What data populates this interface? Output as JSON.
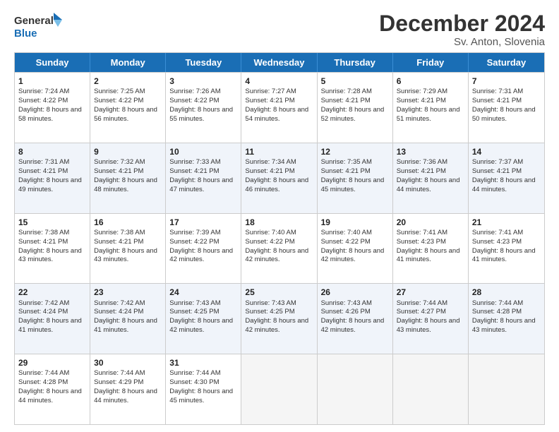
{
  "logo": {
    "line1": "General",
    "line2": "Blue"
  },
  "title": "December 2024",
  "subtitle": "Sv. Anton, Slovenia",
  "days": [
    "Sunday",
    "Monday",
    "Tuesday",
    "Wednesday",
    "Thursday",
    "Friday",
    "Saturday"
  ],
  "weeks": [
    [
      {
        "day": "1",
        "sunrise": "Sunrise: 7:24 AM",
        "sunset": "Sunset: 4:22 PM",
        "daylight": "Daylight: 8 hours and 58 minutes."
      },
      {
        "day": "2",
        "sunrise": "Sunrise: 7:25 AM",
        "sunset": "Sunset: 4:22 PM",
        "daylight": "Daylight: 8 hours and 56 minutes."
      },
      {
        "day": "3",
        "sunrise": "Sunrise: 7:26 AM",
        "sunset": "Sunset: 4:22 PM",
        "daylight": "Daylight: 8 hours and 55 minutes."
      },
      {
        "day": "4",
        "sunrise": "Sunrise: 7:27 AM",
        "sunset": "Sunset: 4:21 PM",
        "daylight": "Daylight: 8 hours and 54 minutes."
      },
      {
        "day": "5",
        "sunrise": "Sunrise: 7:28 AM",
        "sunset": "Sunset: 4:21 PM",
        "daylight": "Daylight: 8 hours and 52 minutes."
      },
      {
        "day": "6",
        "sunrise": "Sunrise: 7:29 AM",
        "sunset": "Sunset: 4:21 PM",
        "daylight": "Daylight: 8 hours and 51 minutes."
      },
      {
        "day": "7",
        "sunrise": "Sunrise: 7:31 AM",
        "sunset": "Sunset: 4:21 PM",
        "daylight": "Daylight: 8 hours and 50 minutes."
      }
    ],
    [
      {
        "day": "8",
        "sunrise": "Sunrise: 7:31 AM",
        "sunset": "Sunset: 4:21 PM",
        "daylight": "Daylight: 8 hours and 49 minutes."
      },
      {
        "day": "9",
        "sunrise": "Sunrise: 7:32 AM",
        "sunset": "Sunset: 4:21 PM",
        "daylight": "Daylight: 8 hours and 48 minutes."
      },
      {
        "day": "10",
        "sunrise": "Sunrise: 7:33 AM",
        "sunset": "Sunset: 4:21 PM",
        "daylight": "Daylight: 8 hours and 47 minutes."
      },
      {
        "day": "11",
        "sunrise": "Sunrise: 7:34 AM",
        "sunset": "Sunset: 4:21 PM",
        "daylight": "Daylight: 8 hours and 46 minutes."
      },
      {
        "day": "12",
        "sunrise": "Sunrise: 7:35 AM",
        "sunset": "Sunset: 4:21 PM",
        "daylight": "Daylight: 8 hours and 45 minutes."
      },
      {
        "day": "13",
        "sunrise": "Sunrise: 7:36 AM",
        "sunset": "Sunset: 4:21 PM",
        "daylight": "Daylight: 8 hours and 44 minutes."
      },
      {
        "day": "14",
        "sunrise": "Sunrise: 7:37 AM",
        "sunset": "Sunset: 4:21 PM",
        "daylight": "Daylight: 8 hours and 44 minutes."
      }
    ],
    [
      {
        "day": "15",
        "sunrise": "Sunrise: 7:38 AM",
        "sunset": "Sunset: 4:21 PM",
        "daylight": "Daylight: 8 hours and 43 minutes."
      },
      {
        "day": "16",
        "sunrise": "Sunrise: 7:38 AM",
        "sunset": "Sunset: 4:21 PM",
        "daylight": "Daylight: 8 hours and 43 minutes."
      },
      {
        "day": "17",
        "sunrise": "Sunrise: 7:39 AM",
        "sunset": "Sunset: 4:22 PM",
        "daylight": "Daylight: 8 hours and 42 minutes."
      },
      {
        "day": "18",
        "sunrise": "Sunrise: 7:40 AM",
        "sunset": "Sunset: 4:22 PM",
        "daylight": "Daylight: 8 hours and 42 minutes."
      },
      {
        "day": "19",
        "sunrise": "Sunrise: 7:40 AM",
        "sunset": "Sunset: 4:22 PM",
        "daylight": "Daylight: 8 hours and 42 minutes."
      },
      {
        "day": "20",
        "sunrise": "Sunrise: 7:41 AM",
        "sunset": "Sunset: 4:23 PM",
        "daylight": "Daylight: 8 hours and 41 minutes."
      },
      {
        "day": "21",
        "sunrise": "Sunrise: 7:41 AM",
        "sunset": "Sunset: 4:23 PM",
        "daylight": "Daylight: 8 hours and 41 minutes."
      }
    ],
    [
      {
        "day": "22",
        "sunrise": "Sunrise: 7:42 AM",
        "sunset": "Sunset: 4:24 PM",
        "daylight": "Daylight: 8 hours and 41 minutes."
      },
      {
        "day": "23",
        "sunrise": "Sunrise: 7:42 AM",
        "sunset": "Sunset: 4:24 PM",
        "daylight": "Daylight: 8 hours and 41 minutes."
      },
      {
        "day": "24",
        "sunrise": "Sunrise: 7:43 AM",
        "sunset": "Sunset: 4:25 PM",
        "daylight": "Daylight: 8 hours and 42 minutes."
      },
      {
        "day": "25",
        "sunrise": "Sunrise: 7:43 AM",
        "sunset": "Sunset: 4:25 PM",
        "daylight": "Daylight: 8 hours and 42 minutes."
      },
      {
        "day": "26",
        "sunrise": "Sunrise: 7:43 AM",
        "sunset": "Sunset: 4:26 PM",
        "daylight": "Daylight: 8 hours and 42 minutes."
      },
      {
        "day": "27",
        "sunrise": "Sunrise: 7:44 AM",
        "sunset": "Sunset: 4:27 PM",
        "daylight": "Daylight: 8 hours and 43 minutes."
      },
      {
        "day": "28",
        "sunrise": "Sunrise: 7:44 AM",
        "sunset": "Sunset: 4:28 PM",
        "daylight": "Daylight: 8 hours and 43 minutes."
      }
    ],
    [
      {
        "day": "29",
        "sunrise": "Sunrise: 7:44 AM",
        "sunset": "Sunset: 4:28 PM",
        "daylight": "Daylight: 8 hours and 44 minutes."
      },
      {
        "day": "30",
        "sunrise": "Sunrise: 7:44 AM",
        "sunset": "Sunset: 4:29 PM",
        "daylight": "Daylight: 8 hours and 44 minutes."
      },
      {
        "day": "31",
        "sunrise": "Sunrise: 7:44 AM",
        "sunset": "Sunset: 4:30 PM",
        "daylight": "Daylight: 8 hours and 45 minutes."
      },
      null,
      null,
      null,
      null
    ]
  ]
}
